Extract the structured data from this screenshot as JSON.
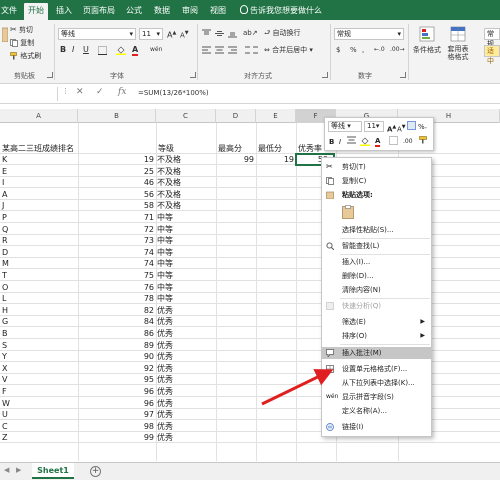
{
  "ribbon_tabs": [
    "文件",
    "开始",
    "插入",
    "页面布局",
    "公式",
    "数据",
    "审阅",
    "视图"
  ],
  "tell_me": "告诉我您想要做什么",
  "clipboard": {
    "cut": "剪切",
    "copy": "复制",
    "format_painter": "格式刷",
    "group_label": "剪贴板"
  },
  "font_group": {
    "font_name": "等线",
    "font_size": "11",
    "group_label": "字体",
    "bold": "B",
    "italic": "I",
    "underline": "U",
    "grow": "A",
    "shrink": "A",
    "wen": "wén"
  },
  "align_group": {
    "wrap": "自动换行",
    "merge": "合并后居中",
    "group_label": "对齐方式"
  },
  "number_group": {
    "format": "常规",
    "currency": "$",
    "percent": "%",
    "comma": ",",
    "group_label": "数字"
  },
  "styles_group": {
    "conditional": "条件格式",
    "table": "套用表格格式",
    "style_right": "常规",
    "style_bad": "适中"
  },
  "formula_bar": {
    "cancel": "✕",
    "enter": "✓",
    "fx": "fx",
    "formula": "=SUM(13/26*100%)"
  },
  "columns": [
    "A",
    "B",
    "C",
    "D",
    "E",
    "F",
    "G",
    "H"
  ],
  "sheet": {
    "title": "某高二三班成绩排名",
    "headers": {
      "grade": "等级",
      "max": "最高分",
      "min": "最低分",
      "excellent": "优秀率"
    },
    "max_value": "99",
    "min_value": "19",
    "f2_value": "50",
    "rows": [
      {
        "name": "K",
        "score": "19",
        "grade": "不及格"
      },
      {
        "name": "E",
        "score": "25",
        "grade": "不及格"
      },
      {
        "name": "I",
        "score": "46",
        "grade": "不及格"
      },
      {
        "name": "A",
        "score": "56",
        "grade": "不及格"
      },
      {
        "name": "J",
        "score": "58",
        "grade": "不及格"
      },
      {
        "name": "P",
        "score": "71",
        "grade": "中等"
      },
      {
        "name": "Q",
        "score": "72",
        "grade": "中等"
      },
      {
        "name": "R",
        "score": "73",
        "grade": "中等"
      },
      {
        "name": "D",
        "score": "74",
        "grade": "中等"
      },
      {
        "name": "M",
        "score": "74",
        "grade": "中等"
      },
      {
        "name": "T",
        "score": "75",
        "grade": "中等"
      },
      {
        "name": "O",
        "score": "76",
        "grade": "中等"
      },
      {
        "name": "L",
        "score": "78",
        "grade": "中等"
      },
      {
        "name": "H",
        "score": "82",
        "grade": "优秀"
      },
      {
        "name": "G",
        "score": "84",
        "grade": "优秀"
      },
      {
        "name": "B",
        "score": "86",
        "grade": "优秀"
      },
      {
        "name": "S",
        "score": "89",
        "grade": "优秀"
      },
      {
        "name": "Y",
        "score": "90",
        "grade": "优秀"
      },
      {
        "name": "X",
        "score": "92",
        "grade": "优秀"
      },
      {
        "name": "V",
        "score": "95",
        "grade": "优秀"
      },
      {
        "name": "F",
        "score": "96",
        "grade": "优秀"
      },
      {
        "name": "W",
        "score": "96",
        "grade": "优秀"
      },
      {
        "name": "U",
        "score": "97",
        "grade": "优秀"
      },
      {
        "name": "C",
        "score": "98",
        "grade": "优秀"
      },
      {
        "name": "Z",
        "score": "99",
        "grade": "优秀"
      }
    ]
  },
  "mini_toolbar": {
    "font_name": "等线",
    "font_size": "11",
    "format": "%"
  },
  "context_menu": {
    "cut": "剪切(T)",
    "copy": "复制(C)",
    "paste_options": "粘贴选项:",
    "paste_special": "选择性粘贴(S)...",
    "smart_lookup": "智能查找(L)",
    "insert": "插入(I)...",
    "delete": "删除(D)...",
    "clear": "清除内容(N)",
    "quick_analysis": "快速分析(Q)",
    "filter": "筛选(E)",
    "sort": "排序(O)",
    "insert_comment": "插入批注(M)",
    "format_cells": "设置单元格格式(F)...",
    "pick_list": "从下拉列表中选择(K)...",
    "phonetic": "显示拼音字段(S)",
    "define_name": "定义名称(A)...",
    "link": "链接(I)"
  },
  "sheet_tab": "Sheet1",
  "add_sheet": "⊕",
  "colors": {
    "excel_green": "#217346",
    "highlight": "#c6c6c6",
    "arrow_red": "#e02020"
  }
}
